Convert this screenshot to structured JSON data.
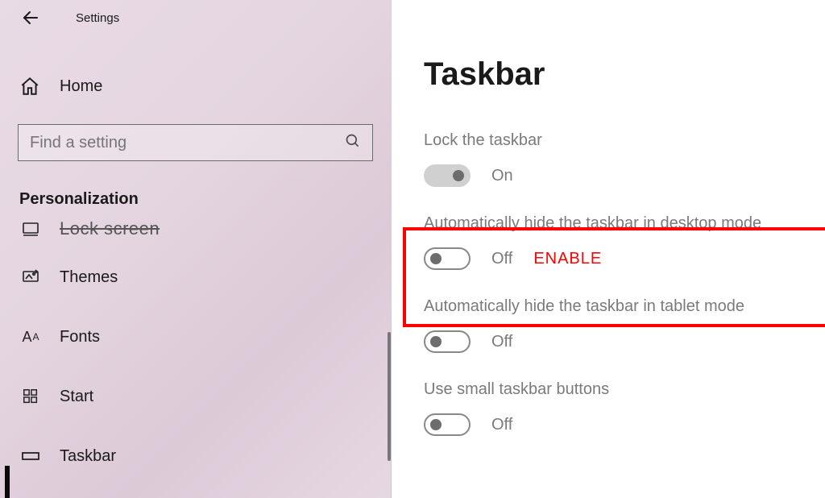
{
  "header": {
    "title": "Settings"
  },
  "sidebar": {
    "home": "Home",
    "search_placeholder": "Find a setting",
    "category": "Personalization",
    "items": [
      {
        "label": "Lock screen"
      },
      {
        "label": "Themes"
      },
      {
        "label": "Fonts"
      },
      {
        "label": "Start"
      },
      {
        "label": "Taskbar"
      }
    ]
  },
  "page": {
    "title": "Taskbar",
    "settings": [
      {
        "label": "Lock the taskbar",
        "state": "On",
        "on": true
      },
      {
        "label": "Automatically hide the taskbar in desktop mode",
        "state": "Off",
        "on": false,
        "note": "ENABLE"
      },
      {
        "label": "Automatically hide the taskbar in tablet mode",
        "state": "Off",
        "on": false
      },
      {
        "label": "Use small taskbar buttons",
        "state": "Off",
        "on": false
      }
    ]
  }
}
